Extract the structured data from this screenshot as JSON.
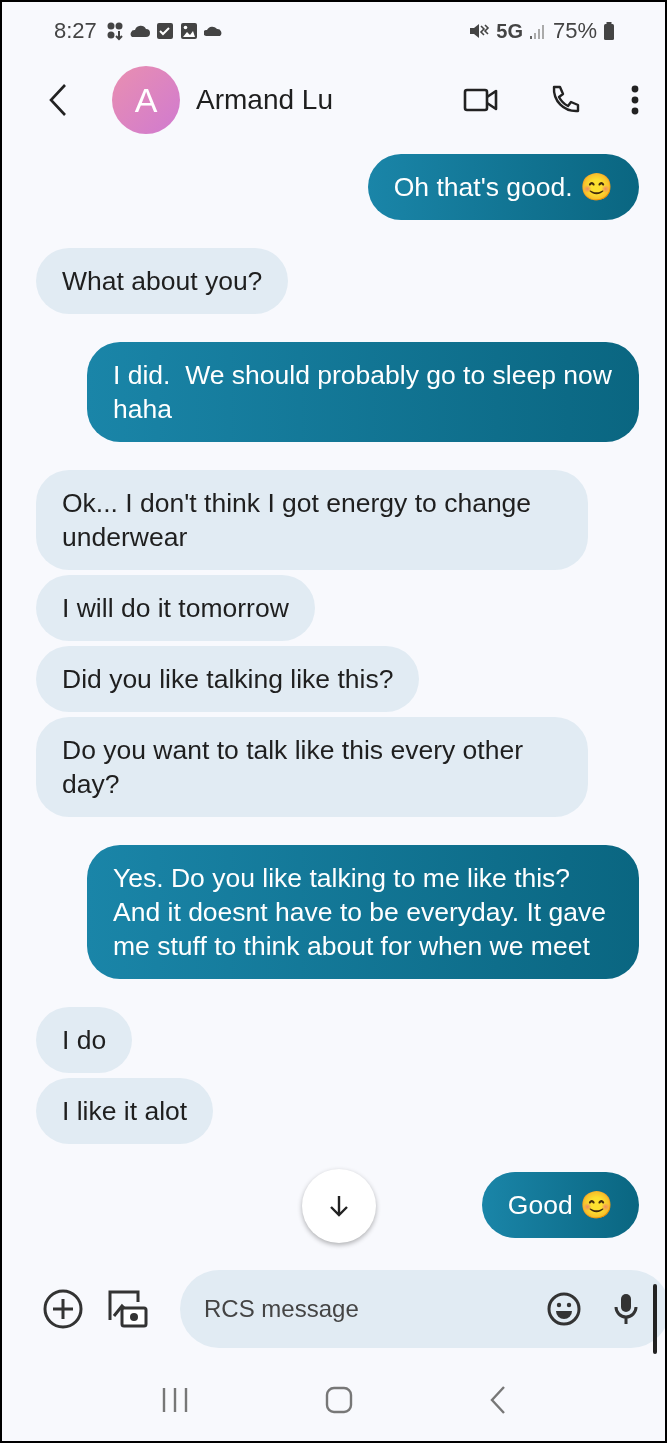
{
  "status_bar": {
    "time": "8:27",
    "network": "5G",
    "battery": "75%"
  },
  "header": {
    "avatar_letter": "A",
    "contact_name": "Armand Lu"
  },
  "messages": [
    {
      "kind": "sent",
      "text": "Oh that's good. 😊"
    },
    {
      "kind": "received",
      "text": "What about you?"
    },
    {
      "kind": "sent",
      "text": "I did.  We should probably go to sleep now haha"
    },
    {
      "kind": "received",
      "text": "Ok... I don't think I got energy to change underwear"
    },
    {
      "kind": "received",
      "text": "I will do it tomorrow"
    },
    {
      "kind": "received",
      "text": "Did you like talking like this?"
    },
    {
      "kind": "received",
      "text": "Do you want to talk like this every other day?"
    },
    {
      "kind": "sent",
      "text": "Yes. Do you like talking to me like this? And it doesnt have to be everyday. It gave me stuff to think about for when we meet"
    },
    {
      "kind": "received",
      "text": "I do"
    },
    {
      "kind": "received",
      "text": "I like it alot"
    },
    {
      "kind": "sent",
      "text": "Good 😊"
    }
  ],
  "compose": {
    "placeholder": "RCS message"
  }
}
